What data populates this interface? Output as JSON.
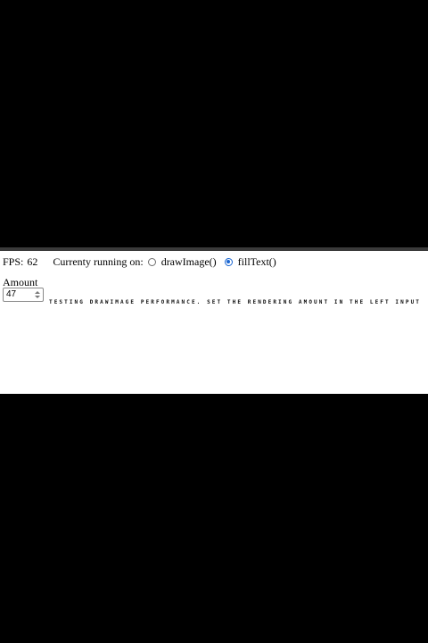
{
  "status": {
    "fps_label": "FPS:",
    "fps_value": "62",
    "mode_label": "Currenty running on:",
    "modes": [
      {
        "label": "drawImage()",
        "selected": false
      },
      {
        "label": "fillText()",
        "selected": true
      }
    ]
  },
  "amount": {
    "label": "Amount",
    "value": "47"
  },
  "canvas": {
    "text": "TESTING DRAWIMAGE PERFORMANCE. SET THE RENDERING AMOUNT IN THE LEFT INPUT"
  },
  "colors": {
    "background": "#000000",
    "page": "#ffffff",
    "radio_accent": "#1a66d2"
  },
  "icons": {
    "spinner_up": "chevron-up-icon",
    "spinner_down": "chevron-down-icon"
  }
}
